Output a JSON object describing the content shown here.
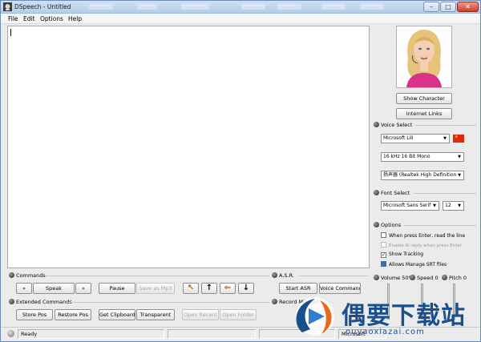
{
  "window": {
    "title": "DSpeech - Untitled"
  },
  "menu": [
    "File",
    "Edit",
    "Options",
    "Help"
  ],
  "character": {
    "show_label": "Show Character",
    "links_label": "Internet Links"
  },
  "voice_select": {
    "title": "Voice Select",
    "voice": "Microsoft Lili",
    "format": "16 kHz 16 Bit Mono",
    "device": "扬声器 (Realtek High Definition"
  },
  "font_select": {
    "title": "Font Select",
    "font": "Microsoft Sans Serif",
    "size": "12"
  },
  "options": {
    "title": "Options",
    "items": [
      {
        "label": "When press Enter, read the line",
        "checked": false,
        "enabled": true
      },
      {
        "label": "Enable AI reply when press Enter",
        "checked": false,
        "enabled": false
      },
      {
        "label": "Show Tracking",
        "checked": true,
        "enabled": true
      },
      {
        "label": "Allows Manage SRT files",
        "checked": true,
        "enabled": true
      }
    ]
  },
  "sliders": {
    "volume": {
      "label": "Volume 50%",
      "value": 50
    },
    "speed": {
      "label": "Speed 0",
      "value": 0
    },
    "pitch": {
      "label": "Pitch 0",
      "value": 0
    }
  },
  "commands": {
    "title": "Commands",
    "prev": "«",
    "speak": "Speak",
    "next": "»",
    "pause": "Pause",
    "save_mp3": "Save as Mp3"
  },
  "extended": {
    "title": "Extended Commands",
    "store_pos": "Store Pos",
    "restore_pos": "Restore Pos",
    "get_clipboard": "Get Clipboard",
    "transparent": "Transparent",
    "open_recent": "Open Recent",
    "open_folder": "Open Folder"
  },
  "asr": {
    "title": "A.S.R.",
    "start": "Start ASR",
    "voice_command": "Voice Command"
  },
  "record": {
    "title": "Record Microph"
  },
  "status": {
    "ready": "Ready",
    "voice_short": "Microsoft"
  },
  "watermark": {
    "title": "偶要下载站",
    "url": "ouyaoxiazai.com"
  },
  "colors": {
    "flag": "#de2910",
    "watermark": "#1b4f8c",
    "title_bar": "#c2d6ee"
  }
}
